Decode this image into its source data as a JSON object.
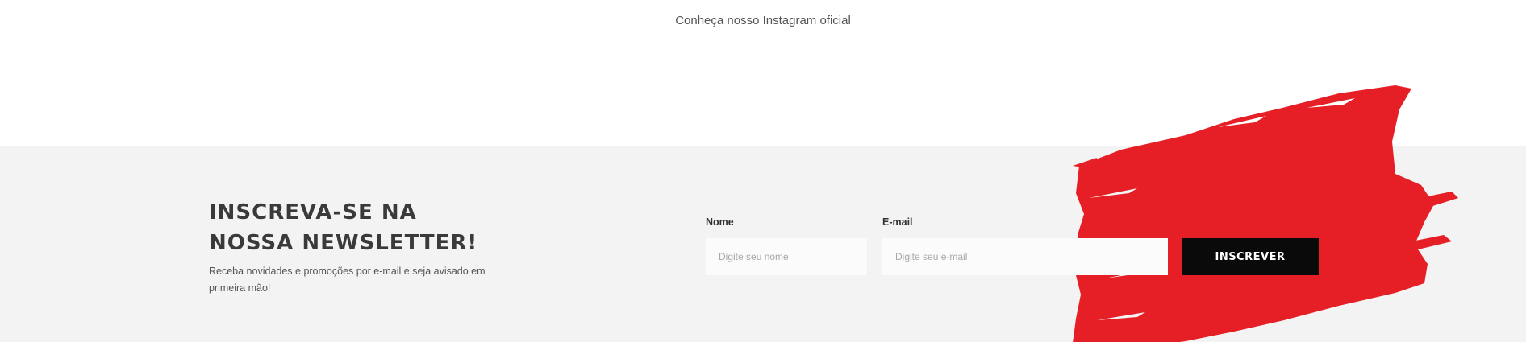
{
  "instagram": {
    "link_text": "Conheça nosso Instagram oficial"
  },
  "newsletter": {
    "title_line1": "INSCREVA-SE NA",
    "title_line2": "NOSSA NEWSLETTER!",
    "description": "Receba novidades e promoções por e-mail e seja avisado em primeira mão!",
    "name_label": "Nome",
    "name_placeholder": "Digite seu nome",
    "email_label": "E-mail",
    "email_placeholder": "Digite seu e-mail",
    "submit_label": "INSCREVER"
  },
  "colors": {
    "brush_red": "#e61e25",
    "section_background": "#f3f3f3",
    "button_background": "#0a0a0a"
  }
}
